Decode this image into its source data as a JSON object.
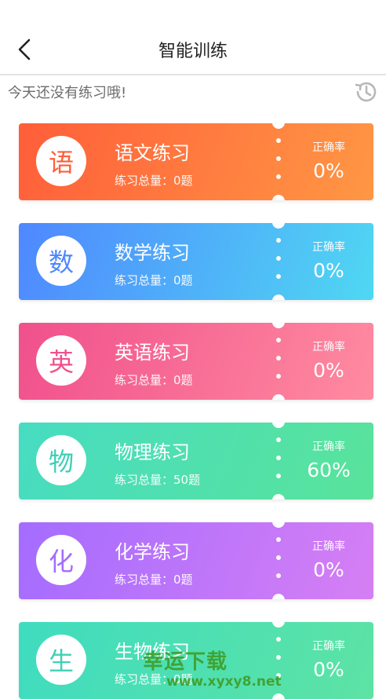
{
  "header": {
    "title": "智能训练"
  },
  "notice": "今天还没有练习哦!",
  "cards": [
    {
      "char": "语",
      "name": "语文练习",
      "total": "练习总量：0题",
      "acc_label": "正确率",
      "acc_value": "0%",
      "grad_from": "#ff5e3a",
      "grad_to": "#ff9744",
      "color": "#ff5e3a"
    },
    {
      "char": "数",
      "name": "数学练习",
      "total": "练习总量：0题",
      "acc_label": "正确率",
      "acc_value": "0%",
      "grad_from": "#4f87ff",
      "grad_to": "#4fd8f2",
      "color": "#4f87ff"
    },
    {
      "char": "英",
      "name": "英语练习",
      "total": "练习总量：0题",
      "acc_label": "正确率",
      "acc_value": "0%",
      "grad_from": "#f0508c",
      "grad_to": "#ff8ba0",
      "color": "#f0508c"
    },
    {
      "char": "物",
      "name": "物理练习",
      "total": "练习总量：50题",
      "acc_label": "正确率",
      "acc_value": "60%",
      "grad_from": "#47dcc2",
      "grad_to": "#59e39a",
      "color": "#3ecfb6"
    },
    {
      "char": "化",
      "name": "化学练习",
      "total": "练习总量：0题",
      "acc_label": "正确率",
      "acc_value": "0%",
      "grad_from": "#a46cff",
      "grad_to": "#d67ff4",
      "color": "#a46cff"
    },
    {
      "char": "生",
      "name": "生物练习",
      "total": "练习总量：0题",
      "acc_label": "正确率",
      "acc_value": "0%",
      "grad_from": "#3fdcc0",
      "grad_to": "#5de3a4",
      "color": "#3fd1b6"
    }
  ],
  "watermark": {
    "text": "幸运下载",
    "url": "www.xyxy8.net"
  }
}
